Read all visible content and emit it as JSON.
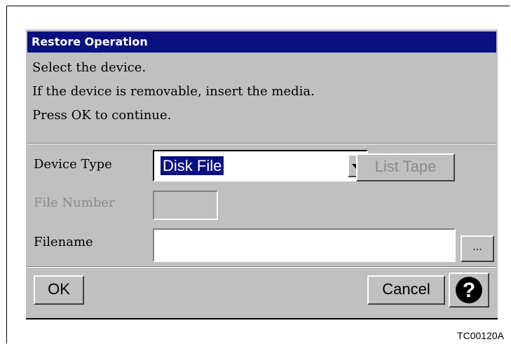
{
  "dialog": {
    "title": "Restore Operation",
    "messages": [
      "Select the device.",
      "If the device is removable, insert the media.",
      "Press OK to continue."
    ]
  },
  "form": {
    "device_type_label": "Device Type",
    "device_type_value": "Disk File",
    "list_tape_label": "List Tape",
    "file_number_label": "File Number",
    "file_number_value": "",
    "filename_label": "Filename",
    "filename_value": "",
    "browse_label": "..."
  },
  "buttons": {
    "ok_label": "OK",
    "cancel_label": "Cancel",
    "help_glyph": "?"
  },
  "figure_id": "TC00120A",
  "colors": {
    "titlebar": "#0a1080",
    "dialog_bg": "#c0c0c0"
  }
}
